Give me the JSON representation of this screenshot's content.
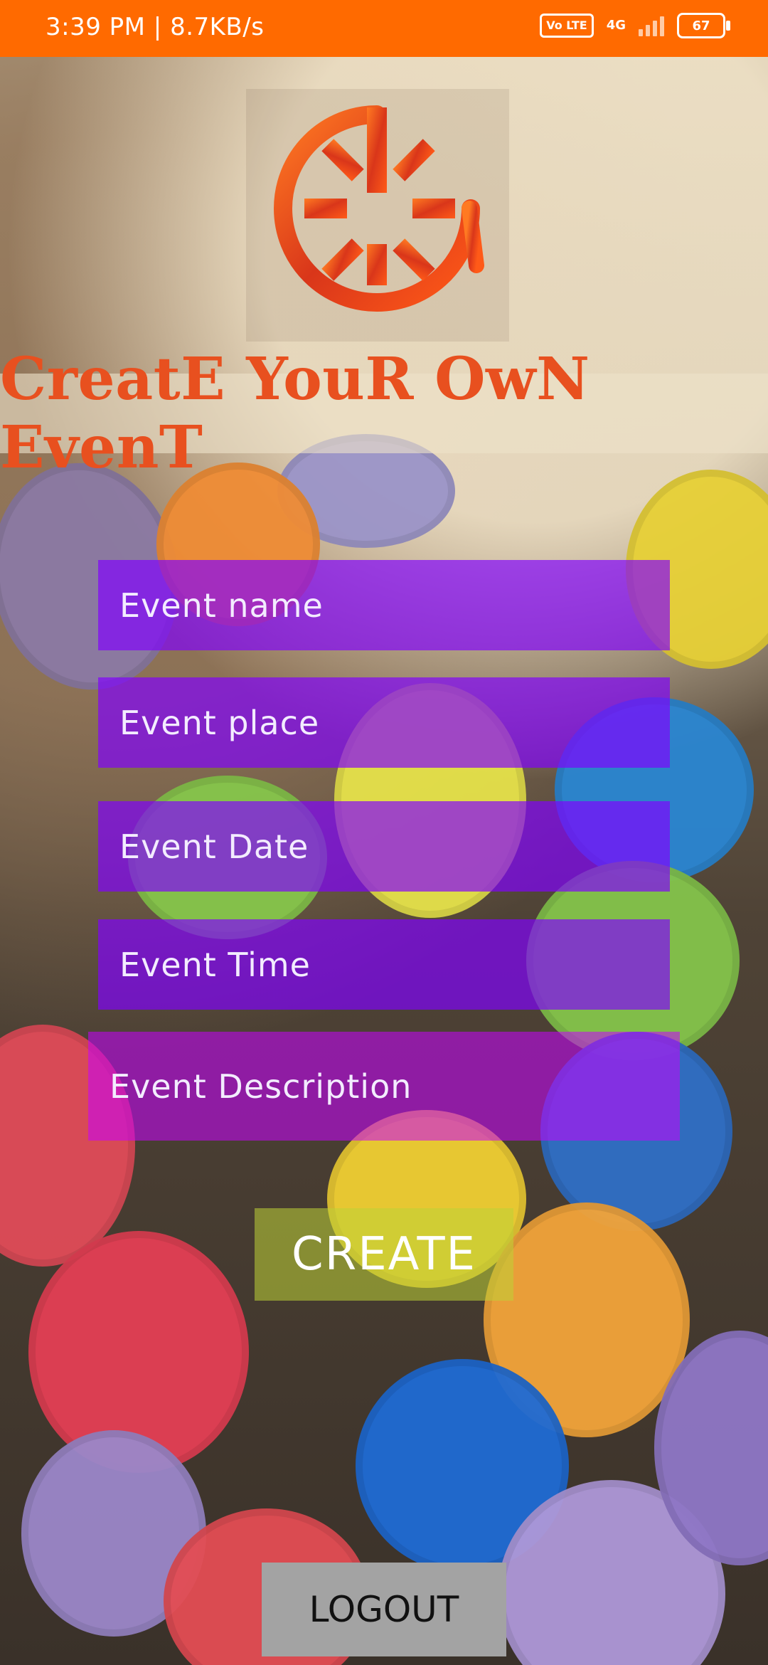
{
  "status_bar": {
    "time_speed": "3:39 PM | 8.7KB/s",
    "volte": "Vo LTE",
    "network": "4G",
    "battery": "67"
  },
  "header": {
    "title": "CreatE YouR OwN EvenT"
  },
  "form": {
    "event_name_placeholder": "Event name",
    "event_place_placeholder": "Event place",
    "event_date_placeholder": "Event Date",
    "event_time_placeholder": "Event Time",
    "event_description_placeholder": "Event Description",
    "create_label": "CREATE",
    "logout_label": "LOGOUT"
  },
  "colors": {
    "status_bar": "#ff6a00",
    "title": "#e8501f",
    "field": "#8000ff",
    "description_field": "#c800ff",
    "create_button": "#bed237",
    "logout_button": "#a3a3a3"
  },
  "icons": {
    "logo": "stopwatch-logo-icon",
    "signal": "cell-signal-icon",
    "battery": "battery-icon"
  }
}
